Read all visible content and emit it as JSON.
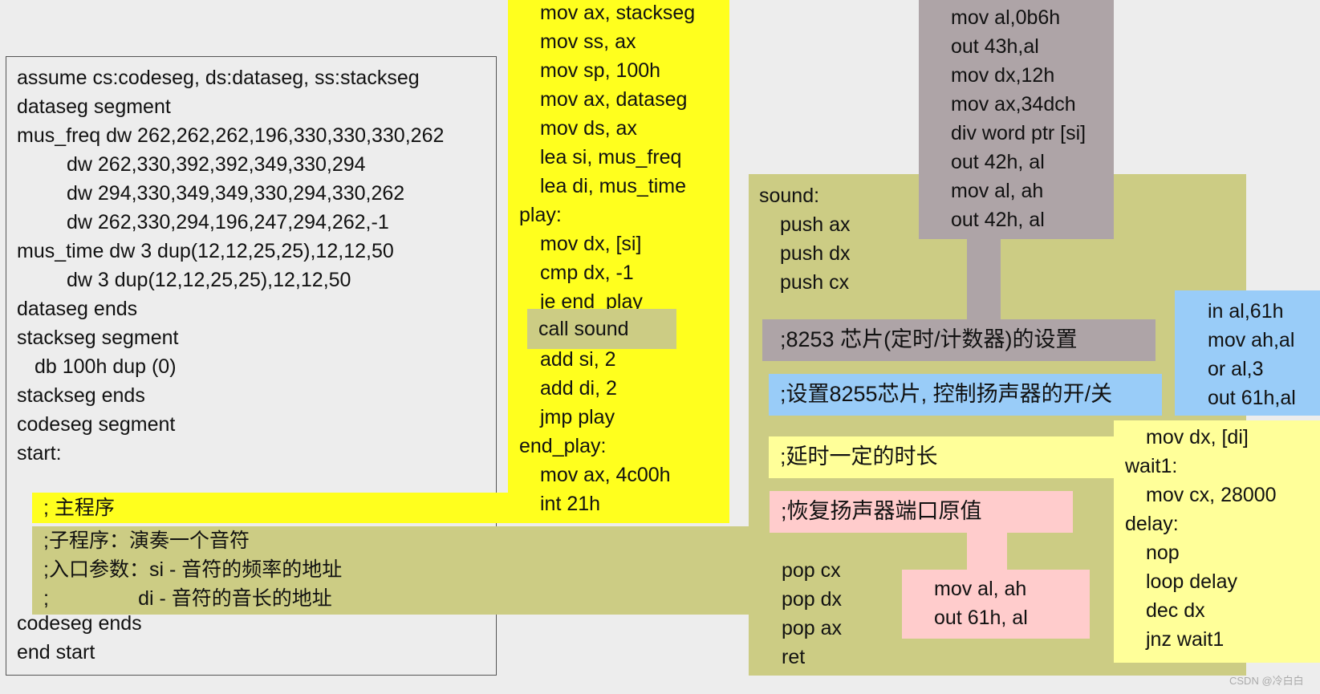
{
  "colors": {
    "background": "#ededed",
    "main_program": "#ffff1e",
    "subroutine": "#cccc84",
    "timer_8253": "#aea4a7",
    "port_8255": "#99ccf8",
    "delay": "#ffff99",
    "restore": "#ffcccc"
  },
  "main_listing": {
    "lines": [
      "assume cs:codeseg, ds:dataseg, ss:stackseg",
      "dataseg segment",
      "mus_freq dw 262,262,262,196,330,330,330,262",
      "dw 262,330,392,392,349,330,294",
      "dw 294,330,349,349,330,294,330,262",
      "dw 262,330,294,196,247,294,262,-1",
      "",
      "mus_time dw 3 dup(12,12,25,25),12,12,50",
      "dw 3 dup(12,12,25,25),12,12,50",
      "dataseg ends",
      "stackseg segment",
      "db 100h dup (0)",
      "stackseg ends",
      "codeseg segment",
      "start:"
    ],
    "tail_lines": [
      "codeseg ends",
      "end start"
    ]
  },
  "main_program": {
    "comment": "; 主程序",
    "lines": [
      "mov ax, stackseg",
      "mov ss, ax",
      "mov sp, 100h",
      "mov ax, dataseg",
      "mov ds, ax",
      "lea si, mus_freq",
      "lea di, mus_time"
    ],
    "label_play": "play:",
    "play_lines": [
      "mov dx, [si]",
      "cmp dx, -1",
      "je end_play"
    ],
    "call_line": "call sound",
    "after_call": [
      "add si, 2",
      "add di, 2",
      "jmp play"
    ],
    "label_end_play": "end_play:",
    "end_lines": [
      "mov ax, 4c00h",
      "int 21h"
    ]
  },
  "subroutine_comment": {
    "lines": [
      ";子程序：演奏一个音符",
      ";入口参数：si - 音符的频率的地址",
      ";                di - 音符的音长的地址"
    ]
  },
  "sound": {
    "label": "sound:",
    "push_lines": [
      "push ax",
      "push dx",
      "push cx"
    ],
    "pop_lines": [
      "pop cx",
      "pop dx",
      "pop ax",
      "ret"
    ]
  },
  "timer_8253": {
    "label": ";8253 芯片(定时/计数器)的设置",
    "lines": [
      "mov al,0b6h",
      "out 43h,al",
      "mov dx,12h",
      "mov ax,34dch",
      "div word ptr [si]",
      "out 42h, al",
      "mov al, ah",
      "out 42h, al"
    ]
  },
  "port_8255": {
    "label": ";设置8255芯片, 控制扬声器的开/关",
    "lines": [
      "in al,61h",
      "mov ah,al",
      "or al,3",
      "out 61h,al"
    ]
  },
  "delay": {
    "label": ";延时一定的时长",
    "lines": [
      "mov dx, [di]",
      "wait1:",
      "mov cx, 28000",
      "delay:",
      "nop",
      "loop delay",
      "dec dx",
      "jnz wait1"
    ]
  },
  "restore": {
    "label": ";恢复扬声器端口原值",
    "lines": [
      "mov al, ah",
      "out 61h, al"
    ]
  },
  "watermark": "CSDN @冷白白"
}
